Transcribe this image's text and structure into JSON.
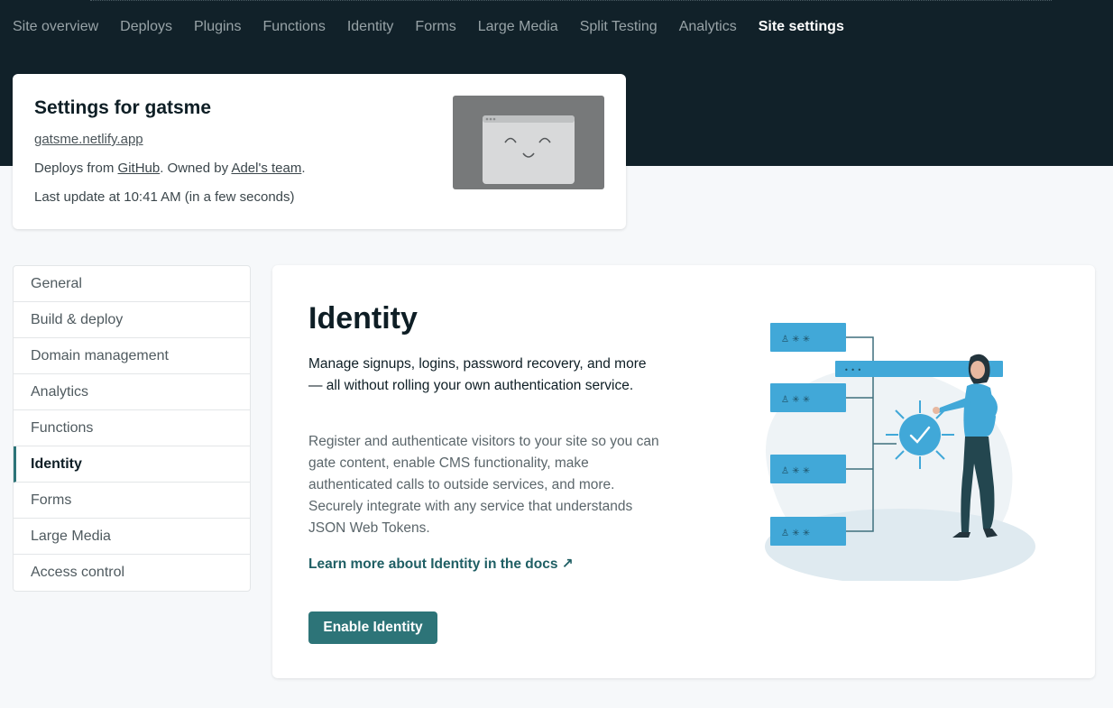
{
  "nav": {
    "items": [
      {
        "label": "Site overview",
        "active": false
      },
      {
        "label": "Deploys",
        "active": false
      },
      {
        "label": "Plugins",
        "active": false
      },
      {
        "label": "Functions",
        "active": false
      },
      {
        "label": "Identity",
        "active": false
      },
      {
        "label": "Forms",
        "active": false
      },
      {
        "label": "Large Media",
        "active": false
      },
      {
        "label": "Split Testing",
        "active": false
      },
      {
        "label": "Analytics",
        "active": false
      },
      {
        "label": "Site settings",
        "active": true
      }
    ]
  },
  "site": {
    "title": "Settings for gatsme",
    "url": "gatsme.netlify.app",
    "deploys_prefix": "Deploys from ",
    "deploys_source": "GitHub",
    "owned_prefix": ". Owned by ",
    "owner": "Adel's team",
    "owned_suffix": ".",
    "last_update": "Last update at 10:41 AM (in a few seconds)"
  },
  "sidebar": {
    "items": [
      {
        "label": "General",
        "active": false
      },
      {
        "label": "Build & deploy",
        "active": false
      },
      {
        "label": "Domain management",
        "active": false
      },
      {
        "label": "Analytics",
        "active": false
      },
      {
        "label": "Functions",
        "active": false
      },
      {
        "label": "Identity",
        "active": true
      },
      {
        "label": "Forms",
        "active": false
      },
      {
        "label": "Large Media",
        "active": false
      },
      {
        "label": "Access control",
        "active": false
      }
    ]
  },
  "identity": {
    "title": "Identity",
    "lead": "Manage signups, logins, password recovery, and more — all without rolling your own authentication service.",
    "body": "Register and authenticate visitors to your site so you can gate content, enable CMS functionality, make authenticated calls to outside services, and more. Securely integrate with any service that understands JSON Web Tokens.",
    "docs_link": "Learn more about Identity in the docs ↗",
    "enable_button": "Enable Identity"
  },
  "colors": {
    "header_bg": "#112129",
    "accent": "#2d7478",
    "illustration_blue": "#41a8d8"
  }
}
